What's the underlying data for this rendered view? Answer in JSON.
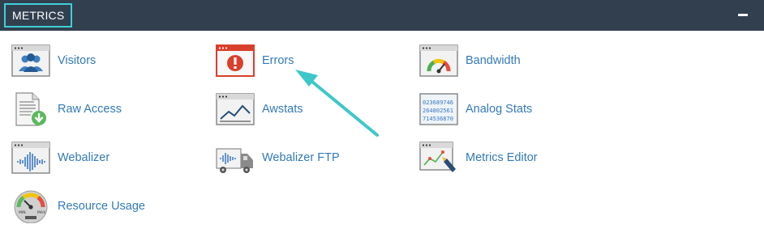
{
  "header": {
    "title": "METRICS",
    "collapse_icon": "minus-icon"
  },
  "items": [
    {
      "label": "Visitors",
      "icon": "visitors-icon"
    },
    {
      "label": "Errors",
      "icon": "errors-icon"
    },
    {
      "label": "Bandwidth",
      "icon": "bandwidth-icon"
    },
    {
      "label": "Raw Access",
      "icon": "raw-access-icon"
    },
    {
      "label": "Awstats",
      "icon": "awstats-icon"
    },
    {
      "label": "Analog Stats",
      "icon": "analog-stats-icon"
    },
    {
      "label": "Webalizer",
      "icon": "webalizer-icon"
    },
    {
      "label": "Webalizer FTP",
      "icon": "webalizer-ftp-icon"
    },
    {
      "label": "Metrics Editor",
      "icon": "metrics-editor-icon"
    },
    {
      "label": "Resource Usage",
      "icon": "resource-usage-icon"
    }
  ],
  "analog_digits": [
    "023689746",
    "264802561",
    "714536870"
  ],
  "gauge_labels": {
    "min": "MIN",
    "max": "MAX"
  },
  "colors": {
    "header_bg": "#323f4f",
    "accent": "#3ed0d8",
    "link": "#337ab7",
    "error_red": "#d9402b",
    "annotation_arrow": "#3ec7c9"
  }
}
